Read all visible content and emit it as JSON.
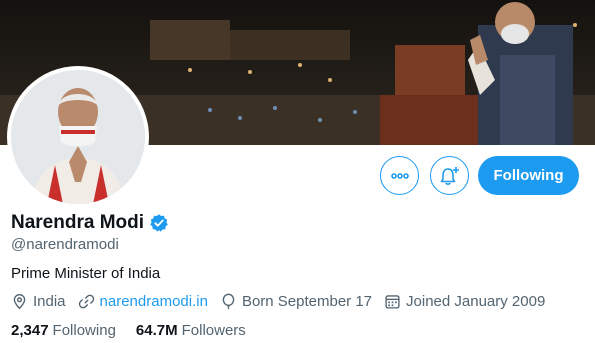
{
  "profile": {
    "name": "Narendra Modi",
    "handle": "@narendramodi",
    "bio": "Prime Minister of India",
    "location": "India",
    "website": "narendramodi.in",
    "born": "Born September 17",
    "joined": "Joined January 2009"
  },
  "stats": {
    "following_count": "2,347",
    "following_label": "Following",
    "followers_count": "64.7M",
    "followers_label": "Followers"
  },
  "actions": {
    "follow_label": "Following"
  },
  "icons": {
    "more": "more-icon",
    "bell": "notification-bell-icon",
    "verified": "verified-badge-icon",
    "location": "location-pin-icon",
    "link": "link-icon",
    "birthday": "balloon-icon",
    "calendar": "calendar-icon"
  },
  "colors": {
    "accent": "#1d9bf0",
    "text_primary": "#0f1419",
    "text_secondary": "#536471"
  }
}
